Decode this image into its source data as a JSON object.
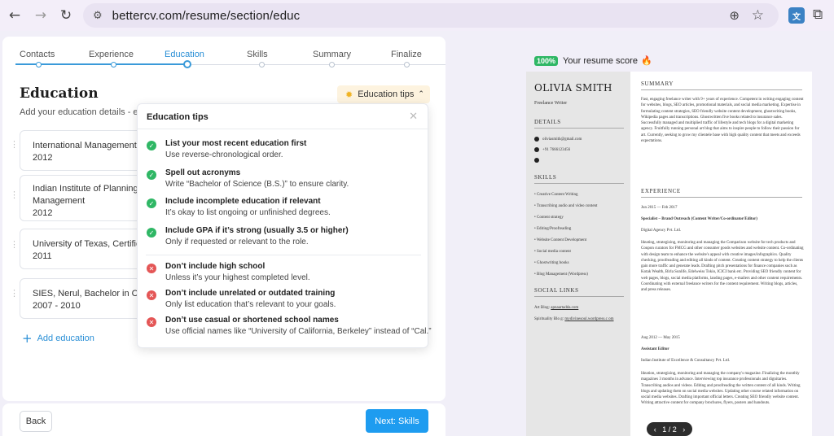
{
  "browser": {
    "back": "←",
    "forward": "→",
    "reload": "↻",
    "url": "bettercv.com/resume/section/educ",
    "icons": [
      "back-arrow-icon",
      "forward-arrow-icon",
      "reload-icon",
      "site-settings-icon",
      "zoom-icon",
      "bookmark-star-icon",
      "translate-extension-icon",
      "extensions-puzzle-icon"
    ]
  },
  "steps": [
    "Contacts",
    "Experience",
    "Education",
    "Skills",
    "Summary",
    "Finalize"
  ],
  "section": {
    "title": "Education",
    "subtitle": "Add your education details - ev",
    "tips_button": "Education tips"
  },
  "education": [
    {
      "line1": "International Management I",
      "line2": "2012",
      "line3": ""
    },
    {
      "line1": "Indian Institute of Planning a",
      "line2": "Management",
      "line3": "2012"
    },
    {
      "line1": "University of Texas, Certifica",
      "line2": "2011",
      "line3": ""
    },
    {
      "line1": "SIES, Nerul, Bachelor in Con",
      "line2": "2007 - 2010",
      "line3": ""
    }
  ],
  "add_education": "Add education",
  "buttons": {
    "back": "Back",
    "next": "Next: Skills"
  },
  "tips": {
    "title": "Education tips",
    "do": [
      {
        "title": "List your most recent education first",
        "desc": "Use reverse-chronological order."
      },
      {
        "title": "Spell out acronyms",
        "desc": "Write “Bachelor of Science (B.S.)” to ensure clarity."
      },
      {
        "title": "Include incomplete education if relevant",
        "desc": "It’s okay to list ongoing or unfinished degrees."
      },
      {
        "title": "Include GPA if it’s strong (usually 3.5 or higher)",
        "desc": "Only if requested or relevant to the role."
      }
    ],
    "dont": [
      {
        "title": "Don’t include high school",
        "desc": "Unless it’s your highest completed level."
      },
      {
        "title": "Don’t include unrelated or outdated training",
        "desc": "Only list education that’s relevant to your goals."
      },
      {
        "title": "Don’t use casual or shortened school names",
        "desc": "Use official names like “University of California, Berkeley” instead of “Cal.”"
      }
    ]
  },
  "score": {
    "pct": "100%",
    "label": "Your resume score"
  },
  "resume": {
    "name": "OLIVIA SMITH",
    "role": "Freelance Writer",
    "details_head": "DETAILS",
    "email": "oliviasmith@gmail.com",
    "phone": "+91 7666123456",
    "skills_head": "SKILLS",
    "skills": [
      "• Creative Content Writing",
      "• Transcribing audio and video content",
      "• Content strategy",
      "• Editing/Proofreading",
      "• Website Content Development",
      "• Social media content",
      "• Ghostwriting books",
      "• Blog Management (Wordpress)"
    ],
    "social_head": "SOCIAL LINKS",
    "social1_label": "Art Blog:",
    "social1_value": "apnaartadda.com",
    "social2_label": "Spirituality Blo g:",
    "social2_value": "mydivinesoul.wordpress.c om",
    "summary_head": "SUMMARY",
    "summary": "Fast, engaging freelance writer with 9+ years of experience. Competent in writing engaging content for websites, blogs, SEO articles, promotional materials, and social media marketing. Expertise in formulating content strategies, SEO friendly website content development, ghostwriting books, Wikipedia pages and transcriptions. Ghostwritten five books related to insurance sales. Successfully managed and multiplied traffic of lifestyle and tech blogs for a digital marketing agency. Fruitfully running personal art blog that aims to inspire people to follow their passion for art. Currently, seeking to grow my clientele base with high quality content that meets and exceeds expectations.",
    "exp_head": "EXPERIENCE",
    "job1_dates": "Jun 2015 — Feb 2017",
    "job1_title": "Specialist – Brand Outreach (Content Writer/Co-ordinator/Editor)",
    "job1_company": "Digital Agency Pvt. Ltd.",
    "job1_desc": "Ideating, strategizing, monitoring and managing the Comparison website for tech products and Coupon curators for FMCG and other consumer goods websites and website content. Co-ordinating with design team to enhance the website's appeal with creative images/infographics. Quality checking, proofreading and editing all kinds of content. Creating content strategy to help the clients gain more traffic and generate leads. Drafting pitch presentations for finance companies such as Kotak Wealth, Birla Sunlife, Edelweiss Tokio, ICICI bank etc. Providing SEO friendly content for web pages, blogs, social media platforms, landing pages, e-mailers and other content requirements. Coordinating with external freelance writers for the content requirement. Writing blogs, articles, and press releases.",
    "job2_dates": "Aug 2012 — May 2015",
    "job2_title": "Assistant Editor",
    "job2_company": "Indian Institute of Excellence & Consultancy Pvt. Ltd.",
    "job2_desc": "Ideation, strategizing, monitoring and managing the company's magazine. Finalizing the monthly magazines 3 months in advance. Interviewing top insurance professionals and dignitaries. Transcribing audios and videos. Editing and proofreading the written content of all kinds. Writing blogs and updating them on social media websites. Updating other course related information on social media websites. Drafting important official letters. Creating SEO friendly website content. Writing attractive content for company brochures, flyers, posters and handouts."
  },
  "pager": {
    "prev": "‹",
    "label": "1 / 2",
    "next": "›"
  }
}
